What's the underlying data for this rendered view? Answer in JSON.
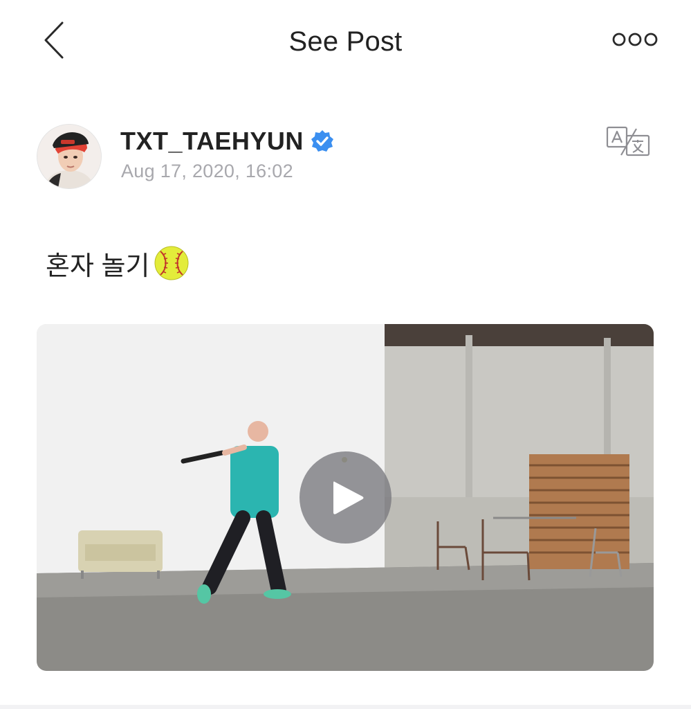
{
  "header": {
    "title": "See Post",
    "back_icon": "chevron-left-icon",
    "more_icon": "more-dots-icon"
  },
  "post": {
    "author": {
      "username": "TXT_TAEHYUN",
      "verified": true,
      "verified_color": "#3b8ff0"
    },
    "timestamp": "Aug 17, 2020, 16:02",
    "text": "혼자 놀기",
    "text_emoji": "softball-icon",
    "media": {
      "type": "video",
      "play_icon": "play-icon"
    }
  },
  "actions": {
    "translate_icon": "translate-icon"
  },
  "colors": {
    "accent": "#3b8ff0",
    "muted_text": "#a8a8ad",
    "title_text": "#222222"
  }
}
